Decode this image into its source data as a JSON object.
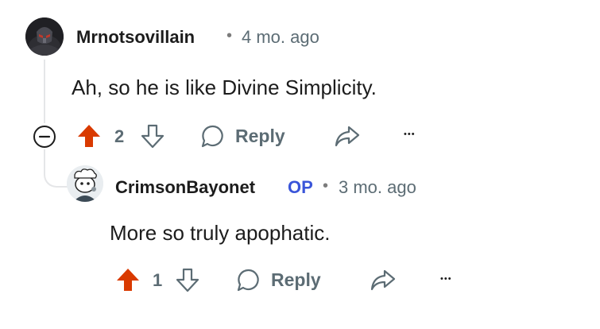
{
  "comments": [
    {
      "author": "Mrnotsovillain",
      "time": "4 mo. ago",
      "separator": "•",
      "body": "Ah, so he is like Divine Simplicity.",
      "votes": "2",
      "reply_label": "Reply",
      "more_label": "•••"
    },
    {
      "author": "CrimsonBayonet",
      "badge": "OP",
      "time": "3 mo. ago",
      "separator": "•",
      "body": "More so truly apophatic.",
      "votes": "1",
      "reply_label": "Reply",
      "more_label": "•••"
    }
  ],
  "colors": {
    "upvote": "#d93a00",
    "meta": "#5c6c74",
    "op": "#3a55d9",
    "thread": "#e5e6e8"
  }
}
